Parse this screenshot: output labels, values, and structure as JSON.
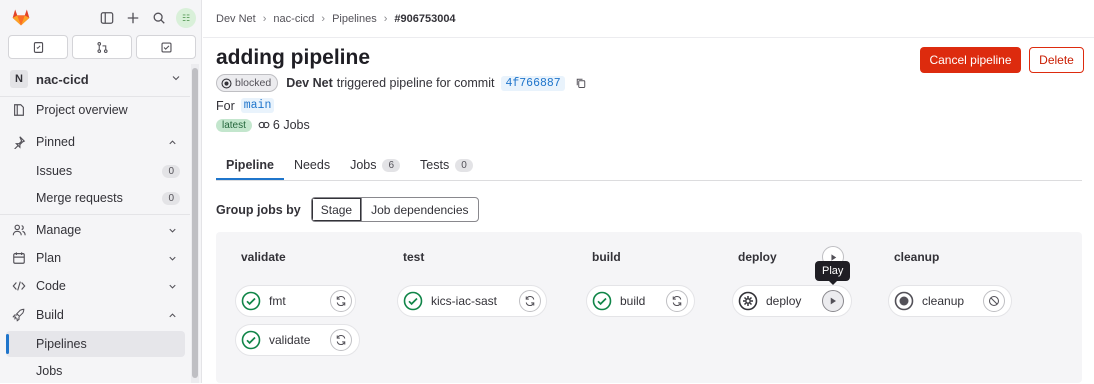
{
  "sidebar": {
    "project_initial": "N",
    "project_name": "nac-cicd",
    "items": [
      {
        "label": "Project overview",
        "icon": "project-icon"
      },
      {
        "label": "Pinned",
        "icon": "pin-icon"
      },
      {
        "label": "Issues",
        "count": "0"
      },
      {
        "label": "Merge requests",
        "count": "0"
      },
      {
        "label": "Manage",
        "icon": "users-icon"
      },
      {
        "label": "Plan",
        "icon": "calendar-icon"
      },
      {
        "label": "Code",
        "icon": "code-icon"
      },
      {
        "label": "Build",
        "icon": "rocket-icon"
      },
      {
        "label": "Pipelines"
      },
      {
        "label": "Jobs"
      }
    ]
  },
  "breadcrumb": [
    "Dev Net",
    "nac-cicd",
    "Pipelines",
    "#906753004"
  ],
  "header": {
    "title": "adding pipeline",
    "cancel_label": "Cancel pipeline",
    "delete_label": "Delete",
    "status": "blocked",
    "user": "Dev Net",
    "triggered_text": "triggered pipeline for commit",
    "commit": "4f766887",
    "for_label": "For",
    "branch": "main",
    "latest_badge": "latest",
    "jobs_count": "6 Jobs"
  },
  "tabs": [
    {
      "label": "Pipeline"
    },
    {
      "label": "Needs"
    },
    {
      "label": "Jobs",
      "count": "6"
    },
    {
      "label": "Tests",
      "count": "0"
    }
  ],
  "group_by": {
    "label": "Group jobs by",
    "options": [
      "Stage",
      "Job dependencies"
    ],
    "selected": "Stage"
  },
  "stages": [
    {
      "name": "validate",
      "jobs": [
        {
          "name": "fmt",
          "status": "success"
        },
        {
          "name": "validate",
          "status": "success"
        }
      ]
    },
    {
      "name": "test",
      "jobs": [
        {
          "name": "kics-iac-sast",
          "status": "success"
        }
      ]
    },
    {
      "name": "build",
      "jobs": [
        {
          "name": "build",
          "status": "success"
        }
      ]
    },
    {
      "name": "deploy",
      "jobs": [
        {
          "name": "deploy",
          "status": "manual"
        }
      ]
    },
    {
      "name": "cleanup",
      "jobs": [
        {
          "name": "cleanup",
          "status": "created"
        }
      ]
    }
  ],
  "tooltip": "Play",
  "colors": {
    "accent": "#1f75cb",
    "danger": "#dd2b0e",
    "success": "#108548"
  }
}
